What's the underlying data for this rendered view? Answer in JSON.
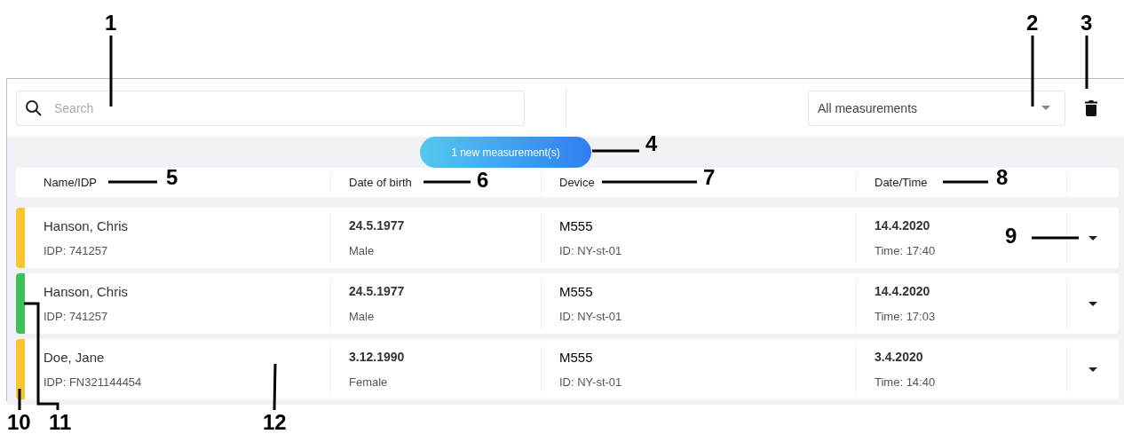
{
  "toolbar": {
    "search": {
      "placeholder": "Search"
    },
    "filter": {
      "value": "All measurements"
    }
  },
  "notification": {
    "label": "1 new measurement(s)"
  },
  "table": {
    "columns": [
      "Name/IDP",
      "Date of birth",
      "Device",
      "Date/Time"
    ],
    "rows": [
      {
        "color": "#fbc531",
        "name": "Hanson, Chris",
        "idp": "IDP: 741257",
        "birth": "24.5.1977",
        "sex": "Male",
        "device": "M555",
        "device_id": "ID: NY-st-01",
        "date": "14.4.2020",
        "time": "Time: 17:40"
      },
      {
        "color": "#3cc257",
        "name": "Hanson, Chris",
        "idp": "IDP: 741257",
        "birth": "24.5.1977",
        "sex": "Male",
        "device": "M555",
        "device_id": "ID: NY-st-01",
        "date": "14.4.2020",
        "time": "Time: 17:03"
      },
      {
        "color": "#fbc531",
        "name": "Doe, Jane",
        "idp": "IDP: FN321144454",
        "birth": "3.12.1990",
        "sex": "Female",
        "device": "M555",
        "device_id": "ID: NY-st-01",
        "date": "3.4.2020",
        "time": "Time: 14:40"
      }
    ]
  },
  "callouts": [
    "1",
    "2",
    "3",
    "4",
    "5",
    "6",
    "7",
    "8",
    "9",
    "10",
    "11",
    "12"
  ]
}
